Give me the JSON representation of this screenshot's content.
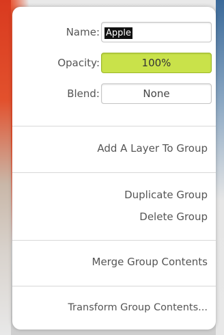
{
  "layer_group": {
    "name_label": "Name:",
    "name_value": "Apple",
    "opacity_label": "Opacity:",
    "opacity_value": "100%",
    "blend_label": "Blend:",
    "blend_value": "None"
  },
  "menu": {
    "add_layer": "Add A Layer To Group",
    "duplicate_group": "Duplicate Group",
    "delete_group": "Delete Group",
    "merge_contents": "Merge Group Contents",
    "transform_contents": "Transform Group Contents..."
  },
  "colors": {
    "opacity_fill": "#c9e24a",
    "selection_bg": "#111111"
  }
}
